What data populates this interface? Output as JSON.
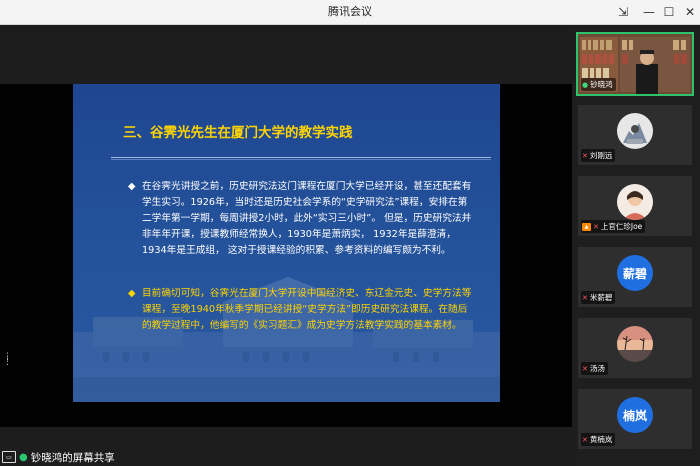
{
  "window": {
    "title": "腾讯会议",
    "controls": {
      "pin": "⇲",
      "minimize": "—",
      "maximize": "☐",
      "close": "✕"
    }
  },
  "slide": {
    "title": "三、谷霁光先生在厦门大学的教学实践",
    "bullet1": {
      "mark": "◆",
      "text": "在谷霁光讲授之前，历史研究法这门课程在厦门大学已经开设，甚至还配套有学生实习。1926年，当时还是历史社会学系的“史学研究法”课程，安排在第二学年第一学期，每周讲授2小时，此外“实习三小时”。 但是，历史研究法并非年年开课，授课教师经常换人，1930年是萧炳实， 1932年是薛澄清， 1934年是王成组， 这对于授课经验的积累、参考资料的编写颇为不利。"
    },
    "bullet2": {
      "mark": "◆",
      "part1": "目前确切可知，谷霁光在厦门大学开设",
      "part2": "中国经济史、东辽金元史、史学方法",
      "part3": "等课程，至晚1940年秋季学期已经讲授“",
      "part4": "史学方法",
      "part5": "”即历史研究法课程。在随后的教学过程中，他编写的《实习题汇》成为史学方法教学实践的基本素材。"
    }
  },
  "share_status": {
    "label": "钞晓鸿的屏幕共享"
  },
  "participants": [
    {
      "name": "钞晓鸿",
      "type": "video",
      "mic": "on"
    },
    {
      "name": "刘刚远",
      "type": "photo",
      "mic": "muted"
    },
    {
      "name": "上官仁珍Joe",
      "type": "photo",
      "mic": "muted",
      "camera_icon": true
    },
    {
      "name": "米薪碧",
      "type": "text",
      "avatar_text": "薪碧",
      "mic": "muted"
    },
    {
      "name": "汤汤",
      "type": "photo",
      "mic": "muted"
    },
    {
      "name": "黄楠岚",
      "type": "text",
      "avatar_text": "楠岚",
      "mic": "muted"
    }
  ],
  "colors": {
    "accent_green": "#2ec36b",
    "avatar_blue": "#1f6fe0",
    "slide_title": "#ffd400"
  }
}
